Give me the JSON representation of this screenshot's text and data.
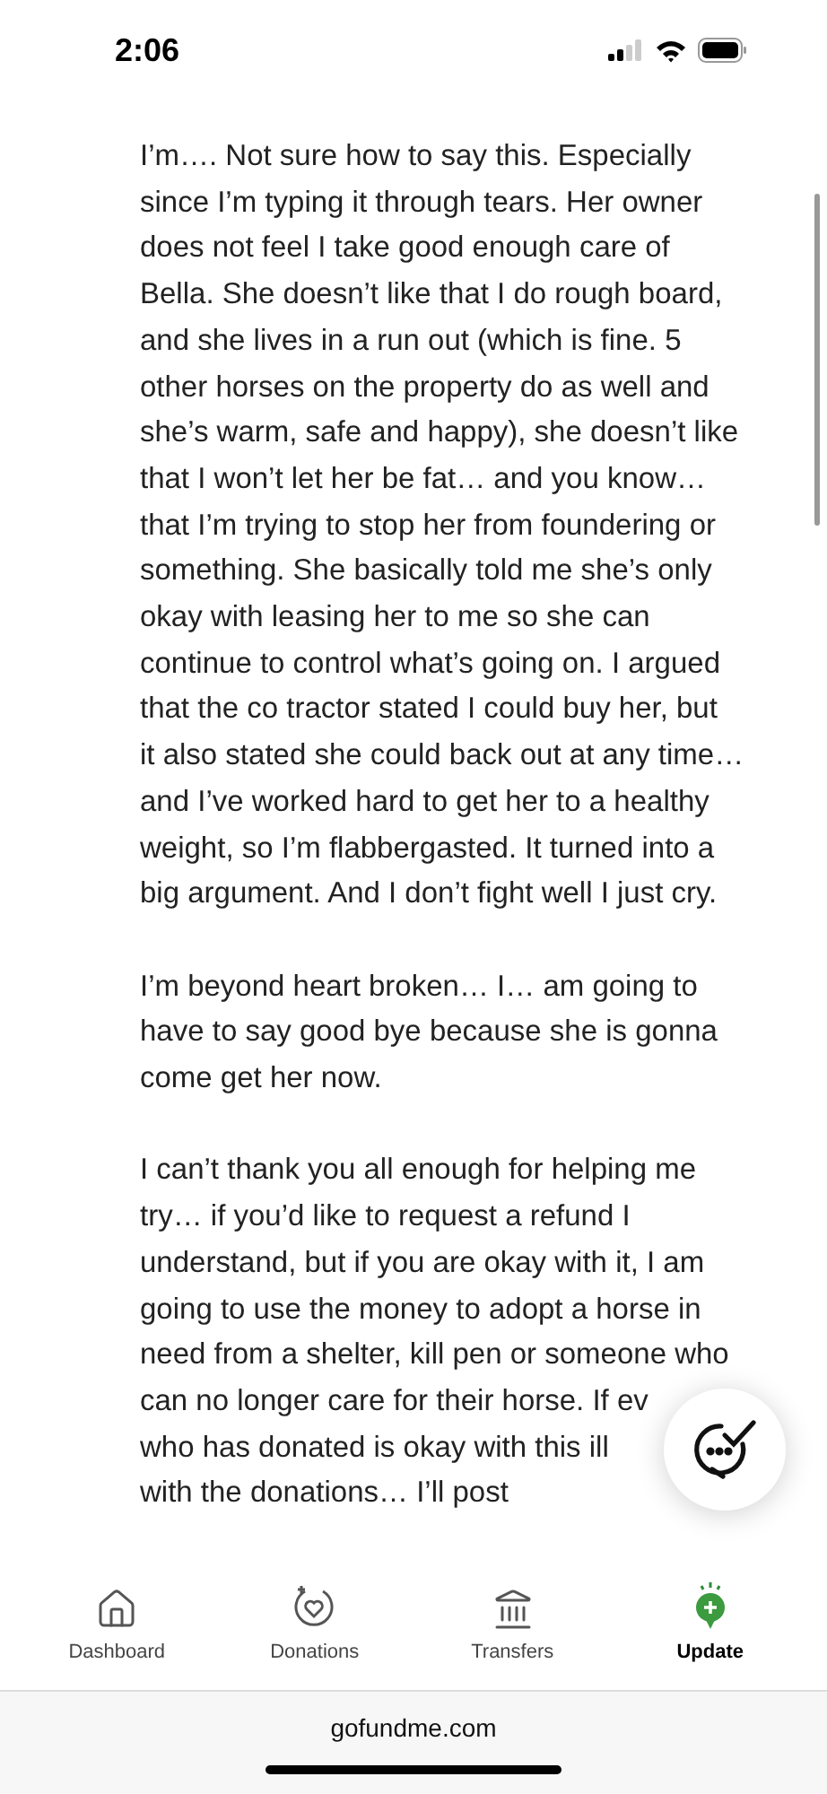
{
  "status_bar": {
    "time": "2:06"
  },
  "update": {
    "paragraphs": [
      {
        "lines": [
          "I’m…. Not sure how to say this. Especially",
          "since I’m typing it through tears. Her owner",
          "does not feel I take good enough care of",
          "Bella. She doesn’t like that I do rough board,",
          "and she lives in a run out (which is fine. 5",
          "other horses on the property do as well and",
          "she’s warm, safe and happy), she doesn’t like",
          "that I won’t let her be fat… and you know…",
          "that I’m trying to stop her from foundering or",
          "something. She basically told me she’s only",
          "okay with leasing her to me so she can",
          "continue to control what’s going on. I argued",
          "that the co tractor stated I could buy her, but",
          "it also stated she could back out at any time…",
          "and I’ve worked hard to get her to a healthy",
          "weight, so I’m flabbergasted. It turned into a",
          "big argument. And I don’t fight well I just cry."
        ]
      },
      {
        "lines": [
          "I’m beyond heart broken… I… am going to",
          "have to say good bye because she is gonna",
          "come get her now."
        ]
      },
      {
        "lines": [
          "I can’t thank you all enough for helping me",
          "try… if you’d like to request a refund I",
          "understand, but if you are okay with it, I am",
          "going to use the money to adopt a horse in",
          "need from a shelter, kill pen or someone who",
          "can no longer care for their horse. If ev",
          "who has donated is okay with this ill",
          "with the donations… I’ll post"
        ]
      }
    ]
  },
  "nav": [
    {
      "label": "Dashboard",
      "kind": "home",
      "selected": false
    },
    {
      "label": "Donations",
      "kind": "donations",
      "selected": false
    },
    {
      "label": "Transfers",
      "kind": "bank",
      "selected": false
    },
    {
      "label": "Update",
      "kind": "update",
      "selected": true
    }
  ],
  "address_bar": {
    "url": "gofundme.com"
  }
}
